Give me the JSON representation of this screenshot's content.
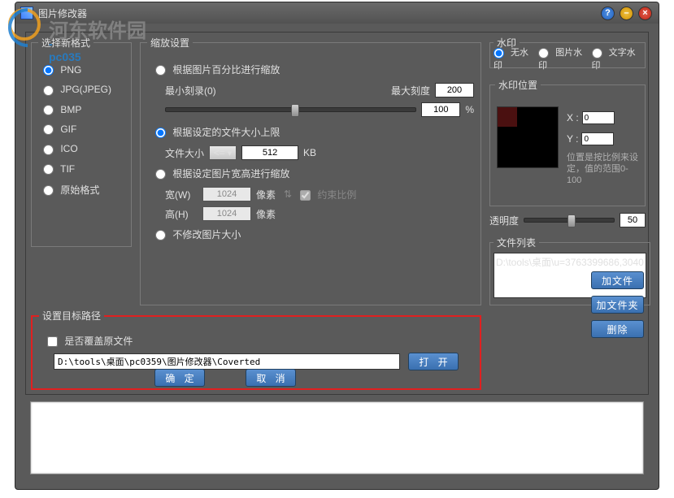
{
  "watermark": {
    "text": "河东软件园",
    "sub": "-pc035"
  },
  "title": "图片修改器",
  "format": {
    "legend": "选择新格式",
    "opts": [
      "PNG",
      "JPG(JPEG)",
      "BMP",
      "GIF",
      "ICO",
      "TIF",
      "原始格式"
    ],
    "selected": 0
  },
  "scale": {
    "legend": "缩放设置",
    "opt_percent": "根据图片百分比进行缩放",
    "min_label": "最小刻录(0)",
    "max_label": "最大刻度",
    "max_value": "200",
    "percent_value": "100",
    "percent_suffix": "%",
    "opt_filesize": "根据设定的文件大小上限",
    "filesize_label": "文件大小",
    "operator": "<=",
    "filesize_value": "512",
    "filesize_unit": "KB",
    "opt_wh": "根据设定图片宽高进行缩放",
    "w_label": "宽(W)",
    "w_value": "1024",
    "h_label": "高(H)",
    "h_value": "1024",
    "px_unit": "像素",
    "constrain": "约束比例",
    "opt_none": "不修改图片大小",
    "selected": 1
  },
  "wm": {
    "legend": "水印",
    "opts": [
      "无水印",
      "图片水印",
      "文字水印"
    ],
    "selected": 0
  },
  "wmpos": {
    "legend": "水印位置",
    "x_label": "X :",
    "y_label": "Y :",
    "x_value": "0",
    "y_value": "0",
    "hint": "位置是按比例来设定，值的范围0-100"
  },
  "opacity": {
    "label": "透明度",
    "value": "50"
  },
  "filelist": {
    "legend": "文件列表",
    "item": "D:\\tools\\桌面\\u=3763399686,3040"
  },
  "target": {
    "legend": "设置目标路径",
    "overwrite_label": "是否覆盖原文件",
    "path": "D:\\tools\\桌面\\pc0359\\图片修改器\\Coverted",
    "open_btn": "打 开"
  },
  "buttons": {
    "ok": "确 定",
    "cancel": "取 消",
    "add_file": "加文件",
    "add_folder": "加文件夹",
    "delete": "删除"
  }
}
